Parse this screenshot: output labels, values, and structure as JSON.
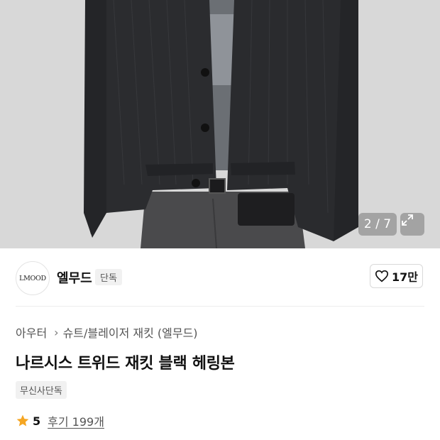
{
  "gallery": {
    "counter": "2 / 7"
  },
  "brand": {
    "logo_text": "LMOOD",
    "name": "엘무드",
    "badge": "단독"
  },
  "like": {
    "count": "17만"
  },
  "breadcrumb": {
    "category": "아우터",
    "subcategory": "슈트/블레이저 재킷 (엘무드)"
  },
  "product": {
    "title": "나르시스 트위드 재킷 블랙 헤링본",
    "exclusive_tag": "무신사단독"
  },
  "rating": {
    "score": "5",
    "reviews": "후기 199개"
  },
  "colors": {
    "star": "#f5a623",
    "text": "#111111",
    "subtext": "#555555"
  }
}
